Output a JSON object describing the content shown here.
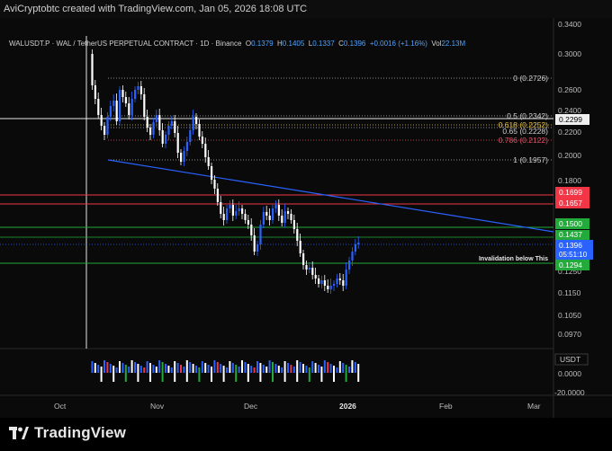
{
  "header": {
    "credit": "AviCryptobtc created with TradingView.com, Jan 05, 2026 18:08 UTC"
  },
  "symbol": {
    "title": "WALUSDT.P · WAL / TetherUS PERPETUAL CONTRACT · 1D · Binance",
    "o_label": "O",
    "o": "0.1379",
    "h_label": "H",
    "h": "0.1405",
    "l_label": "L",
    "l": "0.1337",
    "c_label": "C",
    "c": "0.1396",
    "change": "+0.0016 (+1.16%)",
    "vol_label": "Vol",
    "vol": "22.13M"
  },
  "price_axis": [
    "0.3400",
    "0.3000",
    "0.2600",
    "0.2400",
    "0.2200",
    "0.2000",
    "0.1800",
    "0.1250",
    "0.1150",
    "0.1050",
    "0.0970"
  ],
  "fib_levels": [
    {
      "label": "0 (0.2726)",
      "color": "#cfcfcf"
    },
    {
      "label": "0.5 (0.2342)",
      "color": "#cfcfcf"
    },
    {
      "label": "0.618 (0.2252)",
      "color": "#e8c34a"
    },
    {
      "label": "0.65 (0.2228)",
      "color": "#cfcfcf"
    },
    {
      "label": "0.786 (0.2122)",
      "color": "#e0566a"
    },
    {
      "label": "1 (0.1957)",
      "color": "#cfcfcf"
    }
  ],
  "price_tags": {
    "cross": "0.2299",
    "red_top": "0.1699",
    "red_bottom": "0.1657",
    "green_top": "0.1500",
    "green_mid": "0.1437",
    "current": "0.1396",
    "countdown": "05:51:10",
    "green_low": "0.1294"
  },
  "annotation": "Invalidation below This",
  "volume_axis": {
    "unit": "USDT",
    "zero": "0.0000",
    "neg": "-20.0000"
  },
  "time_axis": [
    "Oct",
    "Nov",
    "Dec",
    "2026",
    "Feb",
    "Mar"
  ],
  "brand": "TradingView",
  "colors": {
    "up": "#2962ff",
    "down": "#ffffff",
    "bg": "#0a0a0a",
    "red": "#f23645",
    "green": "#22ab3a"
  }
}
